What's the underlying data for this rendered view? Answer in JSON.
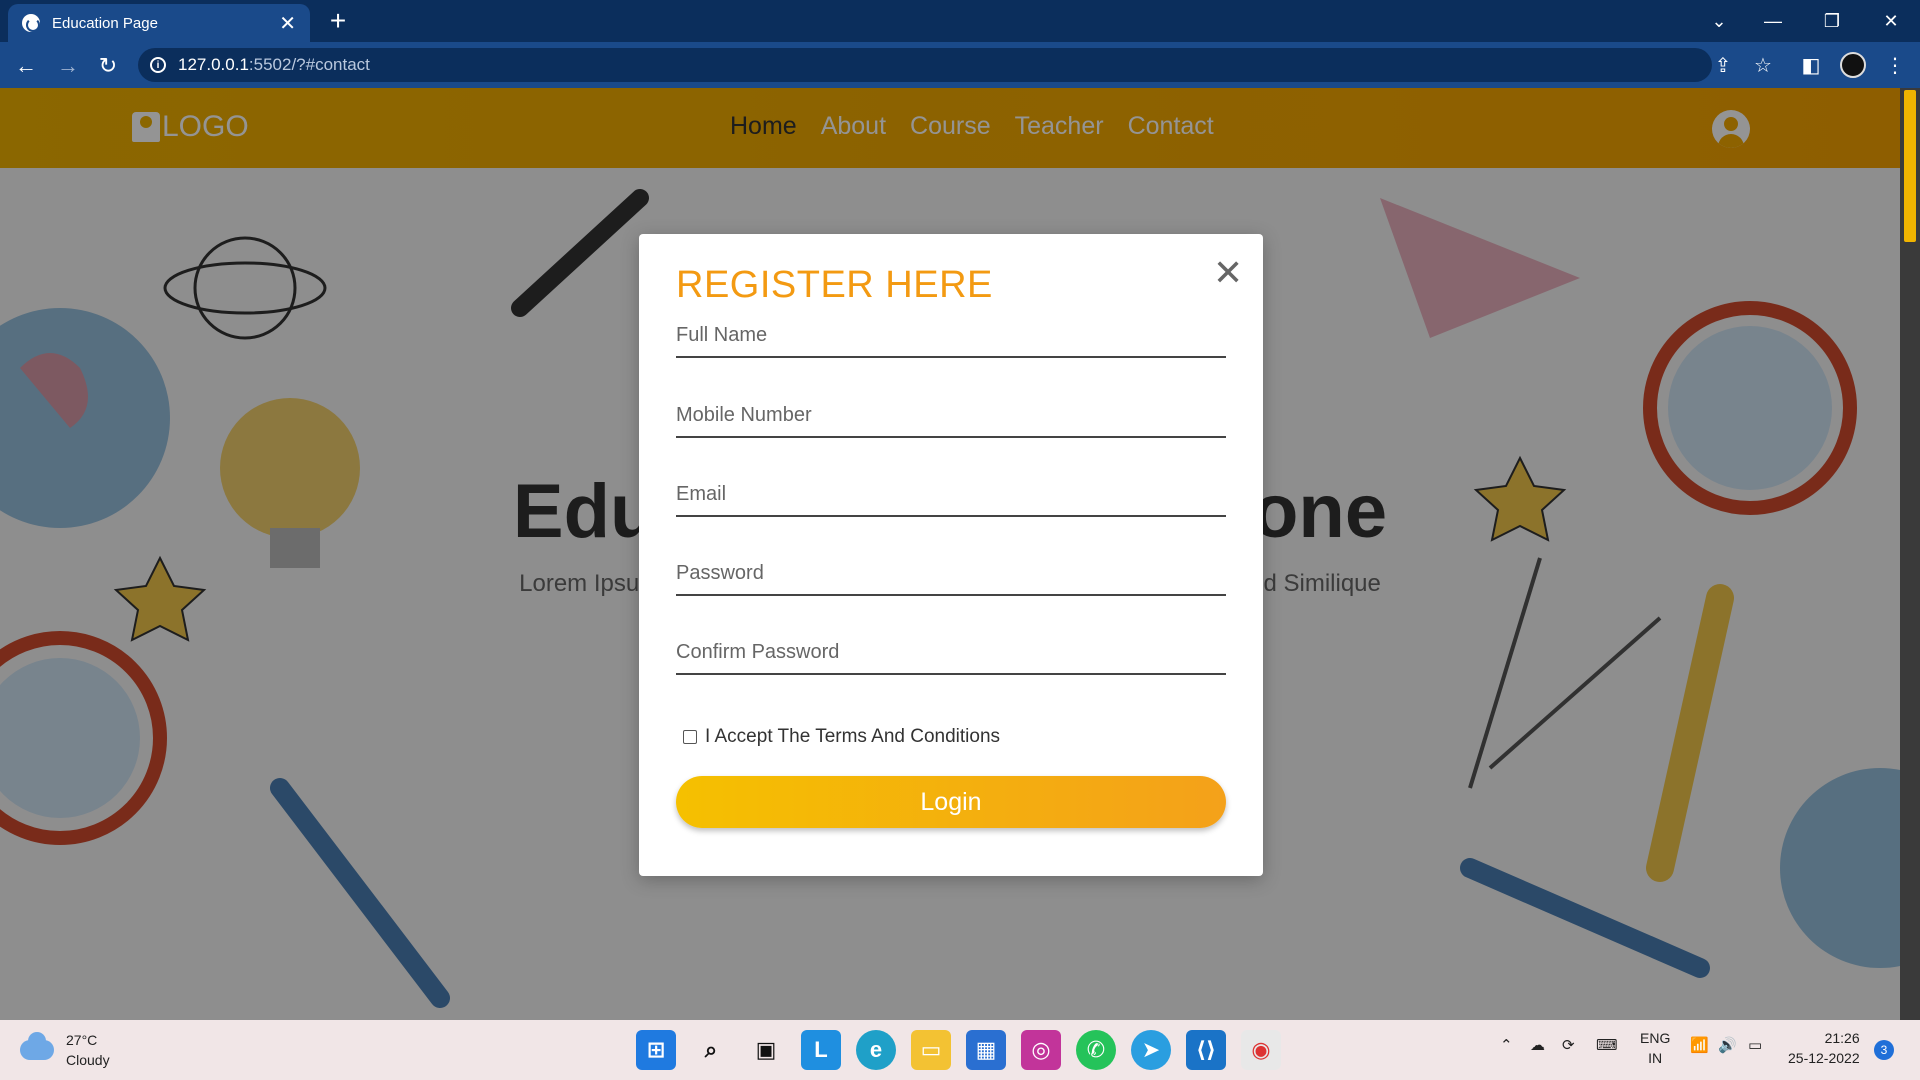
{
  "browser": {
    "tab_title": "Education Page",
    "tab_close": "✕",
    "new_tab": "+",
    "url_host": "127.0.0.1",
    "url_rest": ":5502/?#contact",
    "window_controls": {
      "collapse": "⌄",
      "minimize": "—",
      "restore": "❐",
      "close": "✕"
    }
  },
  "site": {
    "logo_text": "LOGO",
    "nav": [
      "Home",
      "About",
      "Course",
      "Teacher",
      "Contact"
    ],
    "active_nav": "Home",
    "hero_title": "Education For Everyone",
    "hero_text": "Lorem Ipsum Dolor Sit Amet Consectetur Adipisicing Elit. Neque Aliquid Similique Blanditiis Nemo Quibusdam?"
  },
  "modal": {
    "title": "REGISTER HERE",
    "close": "✕",
    "fields": [
      {
        "placeholder": "Full Name",
        "value": ""
      },
      {
        "placeholder": "Mobile Number",
        "value": ""
      },
      {
        "placeholder": "Email",
        "value": ""
      },
      {
        "placeholder": "Password",
        "value": ""
      },
      {
        "placeholder": "Confirm Password",
        "value": ""
      }
    ],
    "terms_label": "I Accept The Terms And Conditions",
    "terms_checked": false,
    "submit_label": "Login"
  },
  "taskbar": {
    "weather_temp": "27°C",
    "weather_desc": "Cloudy",
    "apps": [
      "start-icon",
      "search-icon",
      "task-view-icon",
      "l-app-icon",
      "edge-icon",
      "file-explorer-icon",
      "store-icon",
      "instagram-icon",
      "whatsapp-icon",
      "telegram-icon",
      "vscode-icon",
      "chrome-icon"
    ],
    "lang_top": "ENG",
    "lang_bottom": "IN",
    "time": "21:26",
    "date": "25-12-2022",
    "notifications": "3"
  },
  "colors": {
    "accent": "#f39a12",
    "nav_bg": "#f0b100",
    "chrome_dark": "#0b2e5c",
    "chrome_mid": "#1a4a8a"
  }
}
